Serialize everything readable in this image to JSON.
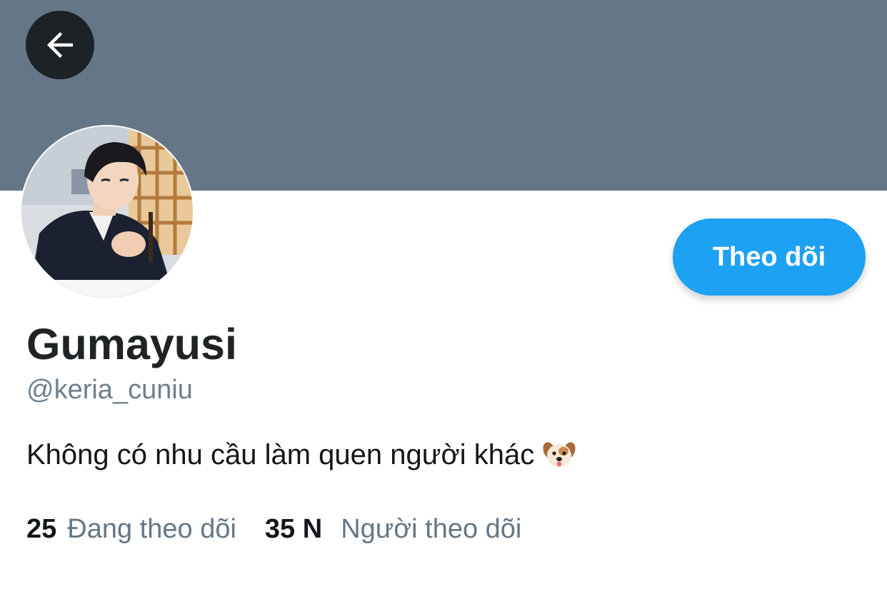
{
  "header": {
    "back_icon": "arrow-left-icon",
    "banner_color": "#657786"
  },
  "profile": {
    "avatar_icon": "profile-photo",
    "display_name": "Gumayusi",
    "handle": "@keria_cuniu",
    "bio": "Không có nhu cầu làm quen người khác",
    "bio_emoji": "dog-face-emoji"
  },
  "actions": {
    "follow_label": "Theo dõi",
    "accent_color": "#1da1f2"
  },
  "stats": {
    "following_count": "25",
    "following_label": "Đang theo dõi",
    "followers_count": "35 N",
    "followers_label": "Người theo dõi"
  }
}
